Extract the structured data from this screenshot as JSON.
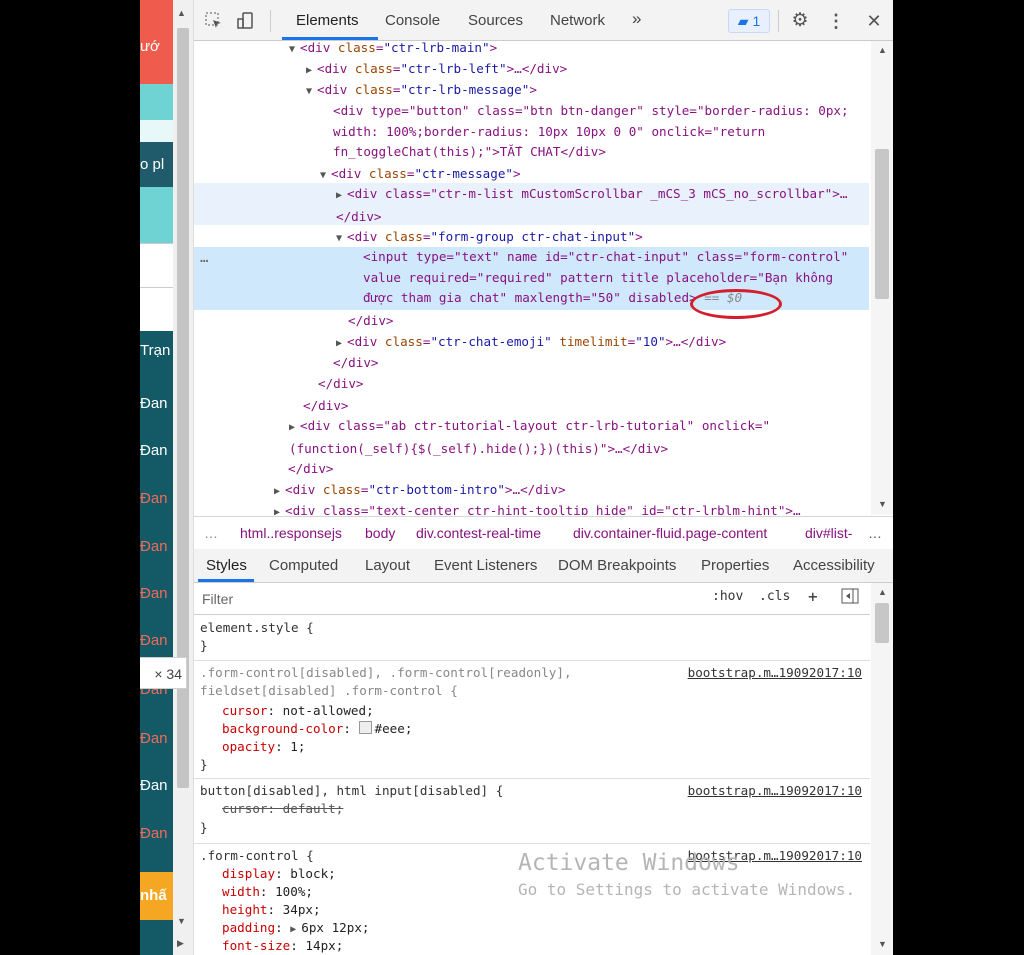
{
  "page_strip": {
    "fragments": [
      "ướ",
      "o pl",
      "Trạn",
      "Đan",
      "Đan",
      "Đan",
      "Đan",
      "Đan",
      "Đan",
      "Đan",
      "Đan",
      "Đan",
      "Đan",
      "nhấ"
    ],
    "size_tooltip": "× 34"
  },
  "toolbar": {
    "tabs": [
      "Elements",
      "Console",
      "Sources",
      "Network"
    ],
    "more": "»",
    "issues_count": "1",
    "icons": [
      "inspect-icon",
      "device-toolbar-icon",
      "issues-icon",
      "gear-icon",
      "kebab-menu-icon",
      "close-icon"
    ]
  },
  "dom": {
    "l1": {
      "tag": "<div ",
      "attr": "class",
      "val": "\"ctr-lrb-main\"",
      "end": ">"
    },
    "l2": {
      "tag": "<div ",
      "attr": "class",
      "val": "\"ctr-lrb-left\"",
      "end": ">…</div>"
    },
    "l3": {
      "tag": "<div ",
      "attr": "class",
      "val": "\"ctr-lrb-message\"",
      "end": ">"
    },
    "l4": {
      "text": "<div type=\"button\" class=\"btn btn-danger\" style=\"border-radius: 0px; width: 100%;border-radius: 10px 10px 0 0\" onclick=\"return fn_toggleChat(this);\">TẮT CHAT</div>"
    },
    "l5": {
      "tag": "<div ",
      "attr": "class",
      "val": "\"ctr-message\"",
      "end": ">"
    },
    "l6": {
      "text": "<div class=\"ctr-m-list mCustomScrollbar _mCS_3 mCS_no_scrollbar\">…</div>"
    },
    "l7": {
      "tag": "<div ",
      "attr": "class",
      "val": "\"form-group ctr-chat-input\"",
      "end": ">"
    },
    "l8": {
      "text": "<input type=\"text\" name id=\"ctr-chat-input\" class=\"form-control\" value required=\"required\" pattern title placeholder=\"Bạn không được tham gia chat\" maxlength=\"50\" disabled>",
      "eq": "== $0"
    },
    "l9": "</div>",
    "l10": {
      "tag": "<div ",
      "attr": "class",
      "val": "\"ctr-chat-emoji\"",
      "attr2": "timelimit",
      "val2": "\"10\"",
      "end": ">…</div>"
    },
    "l11": "</div>",
    "l12": "</div>",
    "l13": "</div>",
    "l14": {
      "text": "<div class=\"ab ctr-tutorial-layout ctr-lrb-tutorial\" onclick=\"(function(_self){$(_self).hide();})(this)\">…</div>"
    },
    "l15": "</div>",
    "l16": {
      "tag": "<div ",
      "attr": "class",
      "val": "\"ctr-bottom-intro\"",
      "end": ">…</div>"
    },
    "l17": {
      "text": "<div class=\"text-center ctr-hint-tooltip hide\" id=\"ctr-lrblm-hint\">…"
    },
    "ellipsis": "…"
  },
  "breadcrumb": {
    "lead": "…",
    "items": [
      "html..responsejs",
      "body",
      "div.contest-real-time",
      "div.container-fluid.page-content",
      "div#list-"
    ],
    "trail": "…"
  },
  "styles_tabs": [
    "Styles",
    "Computed",
    "Layout",
    "Event Listeners",
    "DOM Breakpoints",
    "Properties",
    "Accessibility"
  ],
  "filter": {
    "placeholder": "Filter",
    "hov": ":hov",
    "cls": ".cls",
    "plus": "+"
  },
  "rules": {
    "r1": {
      "selector": "element.style {",
      "close": "}"
    },
    "r2": {
      "selector": ".form-control[disabled], .form-control[readonly],",
      "selector2": "fieldset[disabled] .form-control {",
      "source": "bootstrap.m…19092017:10",
      "decls": [
        {
          "p": "cursor",
          "v": "not-allowed;"
        },
        {
          "p": "background-color",
          "v": "#eee;"
        },
        {
          "p": "opacity",
          "v": "1;"
        }
      ],
      "close": "}"
    },
    "r3": {
      "selector": "button[disabled], html input[disabled] {",
      "source": "bootstrap.m…19092017:10",
      "decl": "cursor: default;",
      "close": "}"
    },
    "r4": {
      "selector": ".form-control {",
      "source": "bootstrap.m…19092017:10",
      "decls": [
        {
          "p": "display",
          "v": "block;"
        },
        {
          "p": "width",
          "v": "100%;"
        },
        {
          "p": "height",
          "v": "34px;"
        },
        {
          "p": "padding",
          "v": "6px 12px;"
        },
        {
          "p": "font-size",
          "v": "14px;"
        }
      ]
    }
  },
  "watermark": {
    "title": "Activate Windows",
    "sub": "Go to Settings to activate Windows."
  },
  "colors": {
    "accent": "#1a73e8",
    "annotation_circle": "#d21f2b",
    "selected_row": "#cfe8fc"
  }
}
